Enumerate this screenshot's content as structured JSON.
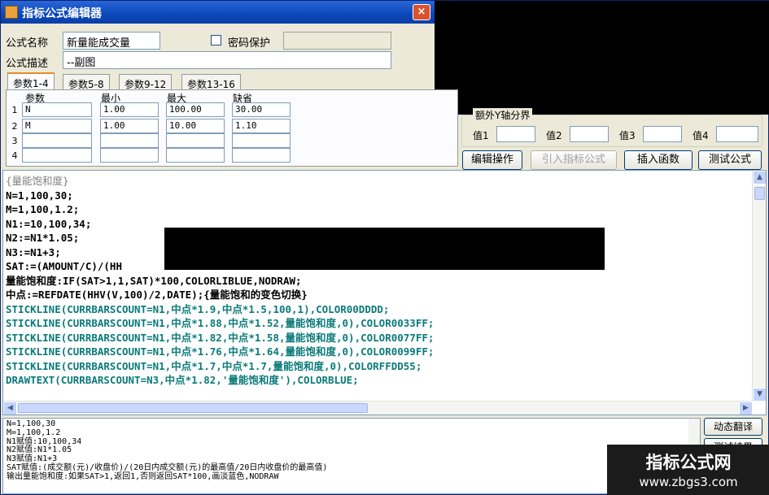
{
  "window": {
    "title": "指标公式编辑器",
    "close_glyph": "×"
  },
  "form": {
    "name_label": "公式名称",
    "name_value": "新量能成交量",
    "password_label": "密码保护",
    "desc_label": "公式描述",
    "desc_value": "--副图"
  },
  "tabs": [
    "参数1-4",
    "参数5-8",
    "参数9-12",
    "参数13-16"
  ],
  "params": {
    "headers": [
      "参数",
      "最小",
      "最大",
      "缺省"
    ],
    "rows": [
      {
        "num": "1",
        "name": "N",
        "min": "1.00",
        "max": "100.00",
        "default": "30.00"
      },
      {
        "num": "2",
        "name": "M",
        "min": "1.00",
        "max": "10.00",
        "default": "1.10"
      },
      {
        "num": "3",
        "name": "",
        "min": "",
        "max": "",
        "default": ""
      },
      {
        "num": "4",
        "name": "",
        "min": "",
        "max": "",
        "default": ""
      }
    ]
  },
  "extra_group": {
    "title": "额外Y轴分界",
    "labels": [
      "值1",
      "值2",
      "值3",
      "值4"
    ]
  },
  "buttons": {
    "edit": "编辑操作",
    "import": "引入指标公式",
    "insert_fn": "插入函数",
    "test": "测试公式"
  },
  "code_lines": [
    "{量能饱和度}",
    "N=1,100,30;",
    "M=1,100,1.2;",
    "N1:=10,100,34;",
    "N2:=N1*1.05;",
    "N3:=N1+3;",
    "SAT:=(AMOUNT/C)/(HH",
    "量能饱和度:IF(SAT>1,1,SAT)*100,COLORLIBLUE,NODRAW;",
    "中点:=REFDATE(HHV(V,100)/2,DATE);{量能饱和的变色切换}",
    "STICKLINE(CURRBARSCOUNT=N1,中点*1.9,中点*1.5,100,1),COLOR00DDDD;",
    "STICKLINE(CURRBARSCOUNT=N1,中点*1.88,中点*1.52,量能饱和度,0),COLOR0033FF;",
    "STICKLINE(CURRBARSCOUNT=N1,中点*1.82,中点*1.58,量能饱和度,0),COLOR0077FF;",
    "STICKLINE(CURRBARSCOUNT=N1,中点*1.76,中点*1.64,量能饱和度,0),COLOR0099FF;",
    "STICKLINE(CURRBARSCOUNT=N1,中点*1.7,中点*1.7,量能饱和度,0),COLORFFDD55;",
    "DRAWTEXT(CURRBARSCOUNT=N3,中点*1.82,'量能饱和度'),COLORBLUE;"
  ],
  "output_lines": [
    "N=1,100,30",
    "M=1,100,1.2",
    "N1赋值:10,100,34",
    "N2赋值:N1*1.05",
    "N3赋值:N1+3",
    "SAT赋值:(成交额(元)/收盘价)/(20日内成交额(元)的最高值/20日内收盘价的最高值)",
    "输出量能饱和度:如果SAT>1,返回1,否则返回SAT*100,画淡蓝色,NODRAW"
  ],
  "side_buttons": {
    "translate": "动态翻译",
    "test_result": "测试结果"
  },
  "watermark": {
    "title": "指标公式网",
    "url": "www.zbgs3.com"
  },
  "scroll_glyphs": {
    "up": "▲",
    "down": "▼",
    "left": "◀",
    "right": "▶"
  },
  "colors": {
    "title_bar": "#0b47b8",
    "number": "#cc9900",
    "function": "#0b7a7a",
    "comment": "#808080"
  }
}
